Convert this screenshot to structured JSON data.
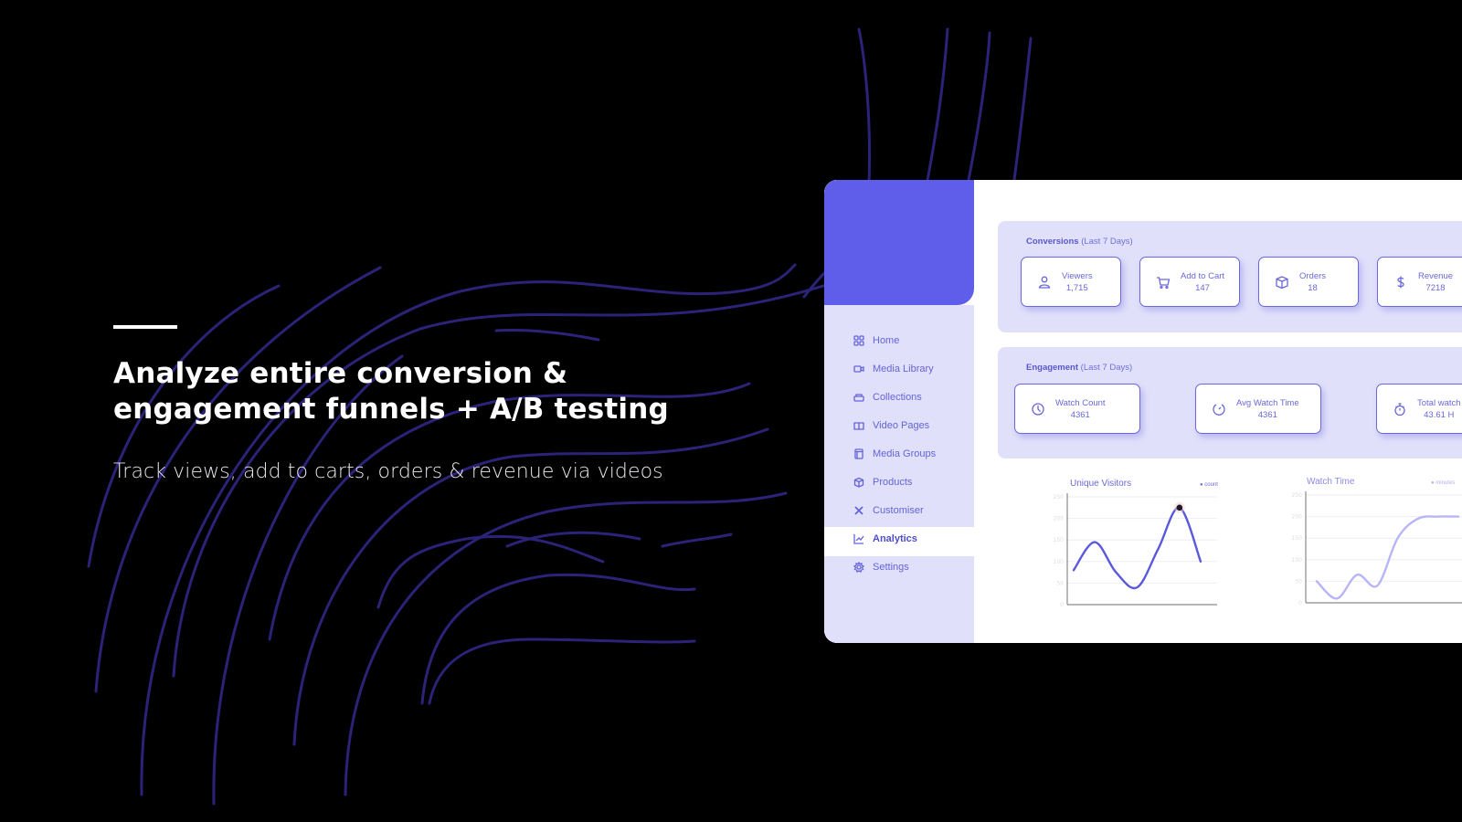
{
  "hero": {
    "title_line1": "Analyze entire conversion &",
    "title_line2": "engagement funnels + A/B testing",
    "subtitle": "Track views, add to carts, orders & revenue via videos"
  },
  "colors": {
    "background": "#000000",
    "accent": "#5f5eea",
    "lavender": "#e1e0fb",
    "curve": "#2a2378",
    "chart_line_1": "#5a58dc",
    "chart_line_2": "#b8b5f6"
  },
  "sidebar": {
    "items": [
      {
        "label": "Home",
        "icon": "grid-icon"
      },
      {
        "label": "Media Library",
        "icon": "video-camera-icon"
      },
      {
        "label": "Collections",
        "icon": "stack-icon"
      },
      {
        "label": "Video Pages",
        "icon": "book-icon"
      },
      {
        "label": "Media Groups",
        "icon": "layout-icon"
      },
      {
        "label": "Products",
        "icon": "box-icon"
      },
      {
        "label": "Customiser",
        "icon": "tools-icon"
      },
      {
        "label": "Analytics",
        "icon": "chart-line-icon",
        "active": true
      },
      {
        "label": "Settings",
        "icon": "gear-icon"
      }
    ]
  },
  "conversions": {
    "title": "Conversions",
    "period": "(Last 7 Days)",
    "stats": [
      {
        "label": "Viewers",
        "value": "1,715",
        "icon": "user-icon"
      },
      {
        "label": "Add to Cart",
        "value": "147",
        "icon": "cart-icon"
      },
      {
        "label": "Orders",
        "value": "18",
        "icon": "box-icon"
      },
      {
        "label": "Revenue",
        "value": "7218",
        "icon": "dollar-icon"
      }
    ]
  },
  "engagement": {
    "title": "Engagement",
    "period": "(Last 7 Days)",
    "stats": [
      {
        "label": "Watch Count",
        "value": "4361",
        "icon": "clock-icon"
      },
      {
        "label": "Avg Watch Time",
        "value": "4361",
        "icon": "timer-icon"
      },
      {
        "label": "Total watch",
        "value": "43.61 H",
        "icon": "stopwatch-icon"
      }
    ]
  },
  "chart_data": [
    {
      "type": "line",
      "title": "Unique Visitors",
      "legend": "count",
      "legend_position": "top-right",
      "ylim": [
        0,
        250
      ],
      "yticks": [
        "0",
        "50",
        "100",
        "150",
        "200",
        "250"
      ],
      "x": [
        0,
        1,
        2,
        3,
        4,
        5,
        6
      ],
      "values": [
        80,
        145,
        75,
        40,
        130,
        225,
        100
      ],
      "highlight_index": 5,
      "grid": true
    },
    {
      "type": "line",
      "title": "Watch Time",
      "legend": "minutes",
      "legend_position": "top-right",
      "ylim": [
        0,
        250
      ],
      "yticks": [
        "0",
        "50",
        "100",
        "150",
        "200",
        "250"
      ],
      "x": [
        0,
        1,
        2,
        3,
        4,
        5,
        6,
        7
      ],
      "values": [
        50,
        10,
        65,
        40,
        150,
        195,
        200,
        200
      ],
      "grid": true
    }
  ]
}
